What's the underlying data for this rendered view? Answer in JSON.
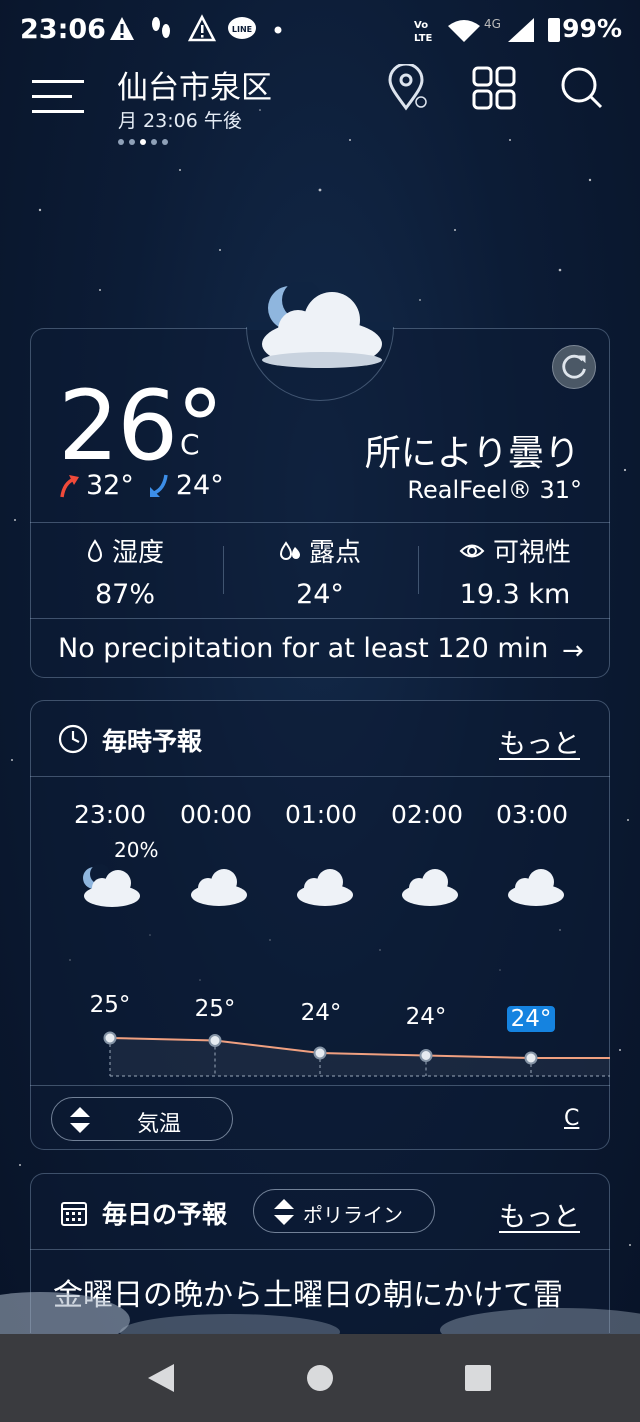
{
  "status": {
    "time": "23:06",
    "battery": "99%",
    "network": "4G",
    "volte": "Vo LTE"
  },
  "header": {
    "location": "仙台市泉区",
    "subtitle": "月 23:06 午後"
  },
  "current": {
    "temp": "26°",
    "unit": "C",
    "high": "32°",
    "low": "24°",
    "condition": "所により曇り",
    "realfeel": "RealFeel® 31°",
    "stats": [
      {
        "label": "湿度",
        "value": "87%",
        "icon": "humidity-icon"
      },
      {
        "label": "露点",
        "value": "24°",
        "icon": "dewpoint-icon"
      },
      {
        "label": "可視性",
        "value": "19.3 km",
        "icon": "eye-icon"
      }
    ],
    "precip": "No precipitation for at least 120 min"
  },
  "hourly": {
    "title": "毎時予報",
    "more": "もっと",
    "hours": [
      {
        "time": "23:00",
        "prob": "20%",
        "temp": "25°",
        "icon": "cloudy-night-icon"
      },
      {
        "time": "00:00",
        "prob": "",
        "temp": "25°",
        "icon": "cloud-icon"
      },
      {
        "time": "01:00",
        "prob": "",
        "temp": "24°",
        "icon": "cloud-icon"
      },
      {
        "time": "02:00",
        "prob": "",
        "temp": "24°",
        "icon": "cloud-icon"
      },
      {
        "time": "03:00",
        "prob": "",
        "temp": "24°",
        "icon": "cloud-icon"
      }
    ],
    "temp_values": [
      25,
      25,
      24,
      24,
      24
    ],
    "selector": "気温",
    "unit": "C"
  },
  "daily": {
    "title": "毎日の予報",
    "selector": "ポリライン",
    "more": "もっと",
    "summary": "金曜日の晩から土曜日の朝にかけて雷"
  },
  "colors": {
    "accent": "#1583e0",
    "high_arrow": "#f04a3a",
    "low_arrow": "#3c8ee8",
    "line": "#f0a080"
  }
}
